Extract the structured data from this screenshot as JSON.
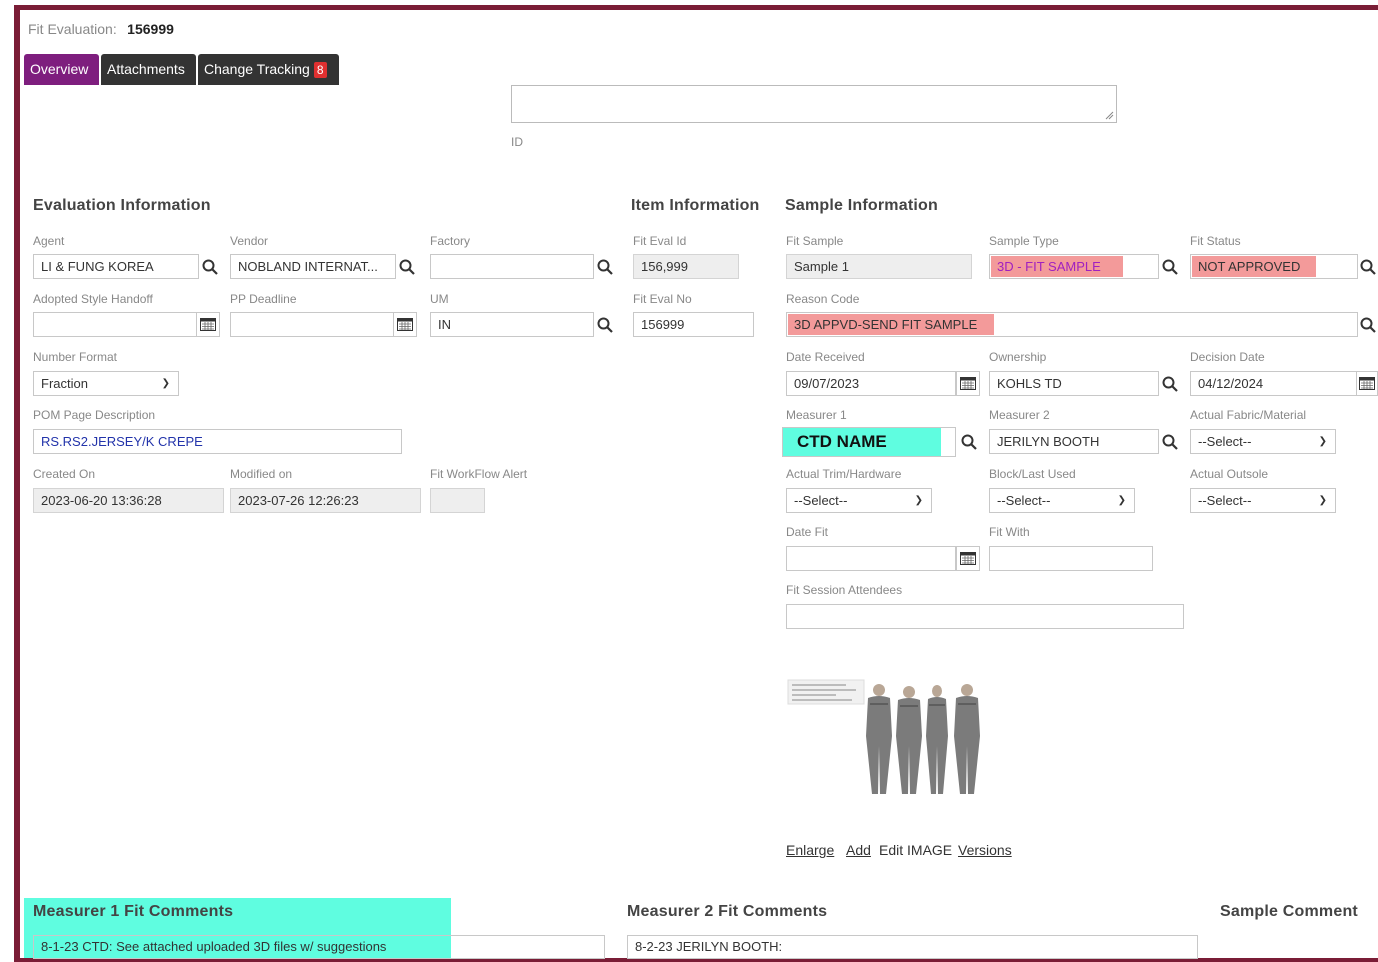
{
  "header": {
    "label": "Fit Evaluation:",
    "value": "156999"
  },
  "tabs": [
    {
      "label": "Overview"
    },
    {
      "label": "Attachments"
    },
    {
      "label": "Change Tracking",
      "badge": "8"
    }
  ],
  "top": {
    "id_label": "ID"
  },
  "sections": {
    "evaluation": "Evaluation Information",
    "item": "Item Information",
    "sample": "Sample Information"
  },
  "evaluation": {
    "agent": {
      "label": "Agent",
      "value": "LI & FUNG KOREA"
    },
    "vendor": {
      "label": "Vendor",
      "value": "NOBLAND INTERNAT..."
    },
    "factory": {
      "label": "Factory",
      "value": ""
    },
    "adopted": {
      "label": "Adopted Style Handoff",
      "value": ""
    },
    "pp_deadline": {
      "label": "PP Deadline",
      "value": ""
    },
    "um": {
      "label": "UM",
      "value": "IN"
    },
    "number_format": {
      "label": "Number Format",
      "value": "Fraction"
    },
    "pom": {
      "label": "POM Page Description",
      "value": "RS.RS2.JERSEY/K CREPE"
    },
    "created": {
      "label": "Created On",
      "value": "2023-06-20 13:36:28"
    },
    "modified": {
      "label": "Modified on",
      "value": "2023-07-26 12:26:23"
    },
    "alert": {
      "label": "Fit WorkFlow Alert",
      "value": ""
    }
  },
  "item": {
    "fit_eval_id": {
      "label": "Fit Eval Id",
      "value": "156,999"
    },
    "fit_eval_no": {
      "label": "Fit Eval No",
      "value": "156999"
    }
  },
  "sample": {
    "fit_sample": {
      "label": "Fit Sample",
      "value": "Sample 1"
    },
    "sample_type": {
      "label": "Sample Type",
      "value": "3D - FIT SAMPLE"
    },
    "fit_status": {
      "label": "Fit Status",
      "value": "NOT APPROVED"
    },
    "reason_code": {
      "label": "Reason Code",
      "value": "3D APPVD-SEND FIT SAMPLE"
    },
    "date_received": {
      "label": "Date Received",
      "value": "09/07/2023"
    },
    "ownership": {
      "label": "Ownership",
      "value": "KOHLS TD"
    },
    "decision_date": {
      "label": "Decision Date",
      "value": "04/12/2024"
    },
    "measurer1": {
      "label": "Measurer 1",
      "value": "CTD NAME"
    },
    "measurer2": {
      "label": "Measurer 2",
      "value": "JERILYN BOOTH"
    },
    "fabric": {
      "label": "Actual Fabric/Material",
      "value": "--Select--"
    },
    "trim": {
      "label": "Actual Trim/Hardware",
      "value": "--Select--"
    },
    "block": {
      "label": "Block/Last Used",
      "value": "--Select--"
    },
    "outsole": {
      "label": "Actual Outsole",
      "value": "--Select--"
    },
    "date_fit": {
      "label": "Date Fit",
      "value": ""
    },
    "fit_with": {
      "label": "Fit With",
      "value": ""
    },
    "attendees": {
      "label": "Fit Session Attendees",
      "value": ""
    }
  },
  "image_links": {
    "enlarge": "Enlarge",
    "add": "Add",
    "edit": "Edit IMAGE",
    "versions": "Versions"
  },
  "comments": {
    "m1_title": "Measurer 1 Fit Comments",
    "m1_value": "8-1-23 CTD: See attached uploaded 3D files w/ suggestions",
    "m2_title": "Measurer 2 Fit Comments",
    "m2_value": "8-2-23 JERILYN BOOTH:",
    "sample_title": "Sample Comment"
  },
  "colors": {
    "frame": "#7a1d36",
    "tab_active": "#7e1e7e",
    "highlight_red": "#f39a9a",
    "highlight_cyan": "#5ffde0"
  }
}
